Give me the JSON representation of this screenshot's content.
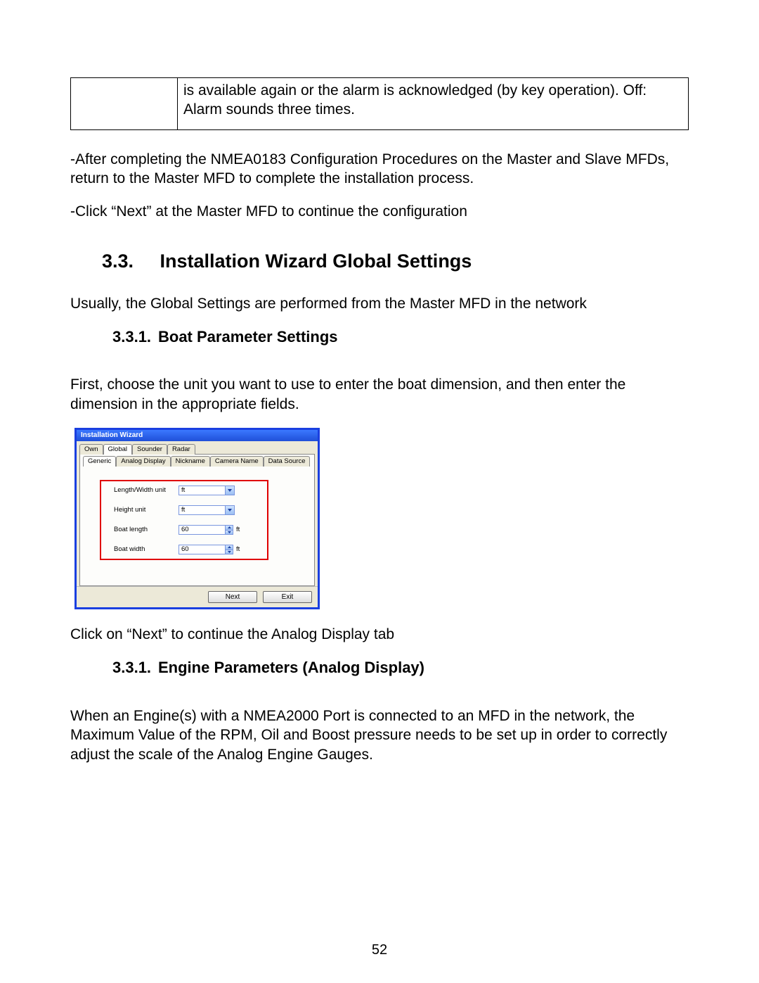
{
  "table_fragment": {
    "text": "is available again or the alarm is acknowledged (by key operation). Off: Alarm sounds three times."
  },
  "para1": "-After completing the NMEA0183 Configuration Procedures on the Master and Slave MFDs, return to the Master MFD to complete the installation process.",
  "para2": "-Click “Next” at the Master MFD to continue the configuration",
  "section": {
    "num": "3.3.",
    "title": "Installation Wizard Global Settings"
  },
  "para3": "Usually, the Global Settings are performed from the Master MFD in the network",
  "sub1": {
    "num": "3.3.1.",
    "title": "Boat Parameter Settings"
  },
  "para4": "First, choose the unit you want to use to enter the boat dimension, and then enter the dimension in the appropriate fields.",
  "shot": {
    "title": "Installation Wizard",
    "tabs_outer": [
      "Own",
      "Global",
      "Sounder",
      "Radar"
    ],
    "tabs_outer_active": 1,
    "tabs_inner": [
      "Generic",
      "Analog Display",
      "Nickname",
      "Camera Name",
      "Data Source"
    ],
    "tabs_inner_active": 0,
    "rows": {
      "lw_unit_label": "Length/Width unit",
      "lw_unit_value": "ft",
      "h_unit_label": "Height unit",
      "h_unit_value": "ft",
      "len_label": "Boat length",
      "len_value": "60",
      "len_suffix": "ft",
      "wid_label": "Boat width",
      "wid_value": "60",
      "wid_suffix": "ft"
    },
    "buttons": {
      "next": "Next",
      "exit": "Exit"
    }
  },
  "para5": "Click on “Next” to continue the Analog Display tab",
  "sub2": {
    "num": "3.3.1.",
    "title": "Engine Parameters (Analog Display)"
  },
  "para6": "When an Engine(s) with a NMEA2000 Port is connected to an MFD in the network, the Maximum Value of the RPM, Oil and Boost pressure needs to be set up in order to correctly adjust the scale of the Analog Engine Gauges.",
  "page_number": "52"
}
